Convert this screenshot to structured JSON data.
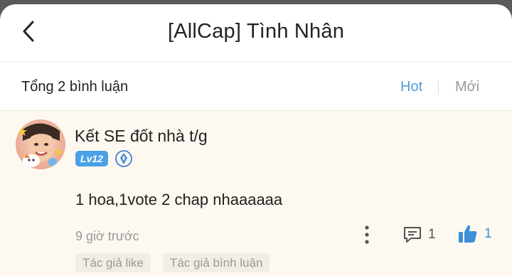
{
  "header": {
    "title": "[AllCap] Tình Nhân"
  },
  "comments_bar": {
    "total_label": "Tổng 2 bình luận",
    "sort_options": [
      "Hot",
      "Mới"
    ],
    "active_sort": "Hot"
  },
  "comment": {
    "username": "Kết SE đốt nhà t/g",
    "level": "Lv12",
    "content": "1 hoa,1vote 2 chap nhaaaaaa",
    "time": "9 giờ trước",
    "reply_count": "1",
    "like_count": "1",
    "tags": [
      "Tác giả like",
      "Tác giả bình luận"
    ]
  },
  "colors": {
    "accent": "#4a9fdc",
    "like": "#3d8fd6",
    "level_badge": "#4aa1e6",
    "comment_bg": "#fdf8f0"
  },
  "icons": {
    "back": "chevron-left-icon",
    "badge": "diamond-badge-icon",
    "more": "more-vertical-icon",
    "reply": "comment-icon",
    "like": "thumbs-up-icon"
  }
}
